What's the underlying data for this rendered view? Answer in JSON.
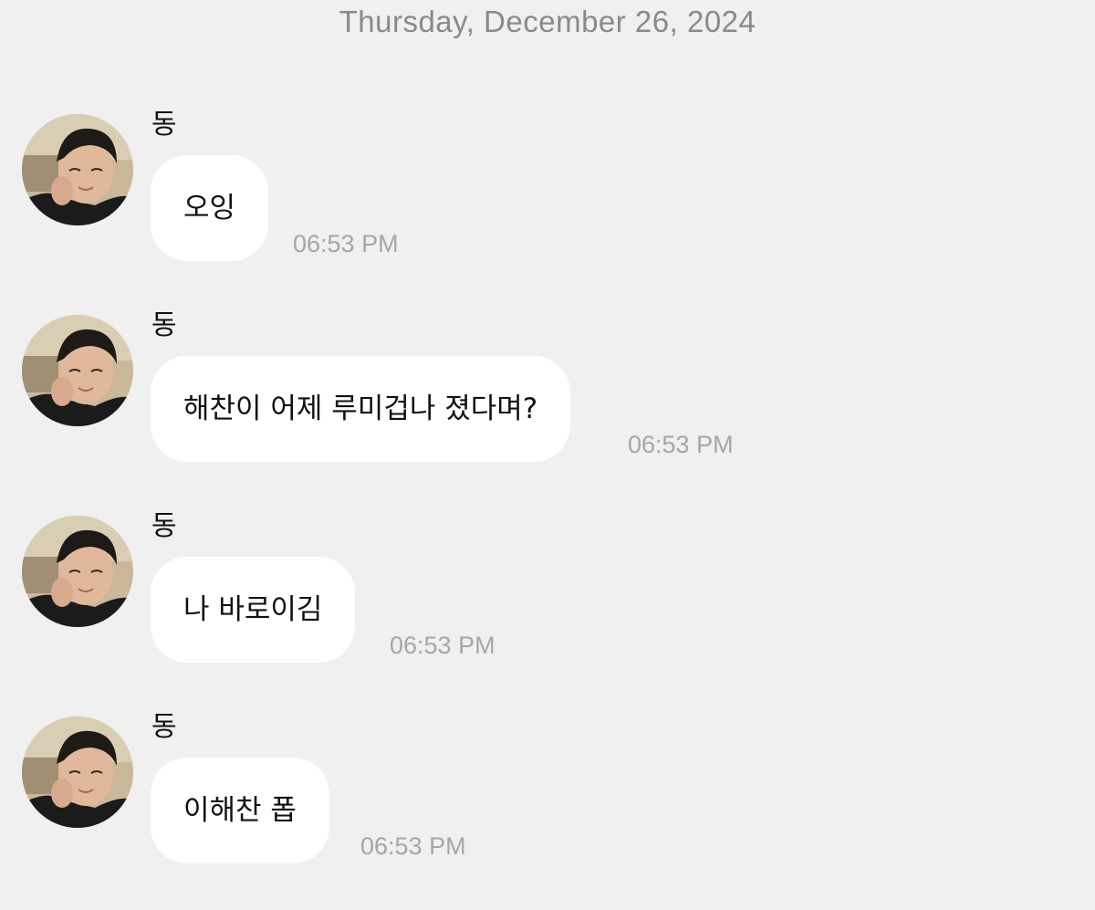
{
  "date_header": "Thursday, December 26, 2024",
  "messages": [
    {
      "sender": "동",
      "text": "오잉",
      "time": "06:53 PM"
    },
    {
      "sender": "동",
      "text": "해찬이 어제 루미겁나 졌다며?",
      "time": "06:53 PM"
    },
    {
      "sender": "동",
      "text": "나 바로이김",
      "time": "06:53 PM"
    },
    {
      "sender": "동",
      "text": "이해찬 폽",
      "time": "06:53 PM"
    }
  ],
  "colors": {
    "background": "#f0f0f0",
    "bubble": "#ffffff",
    "timestamp": "#a6a6a6",
    "date": "#8a8a8a"
  },
  "icons": {
    "avatar": "profile-photo-avatar"
  }
}
